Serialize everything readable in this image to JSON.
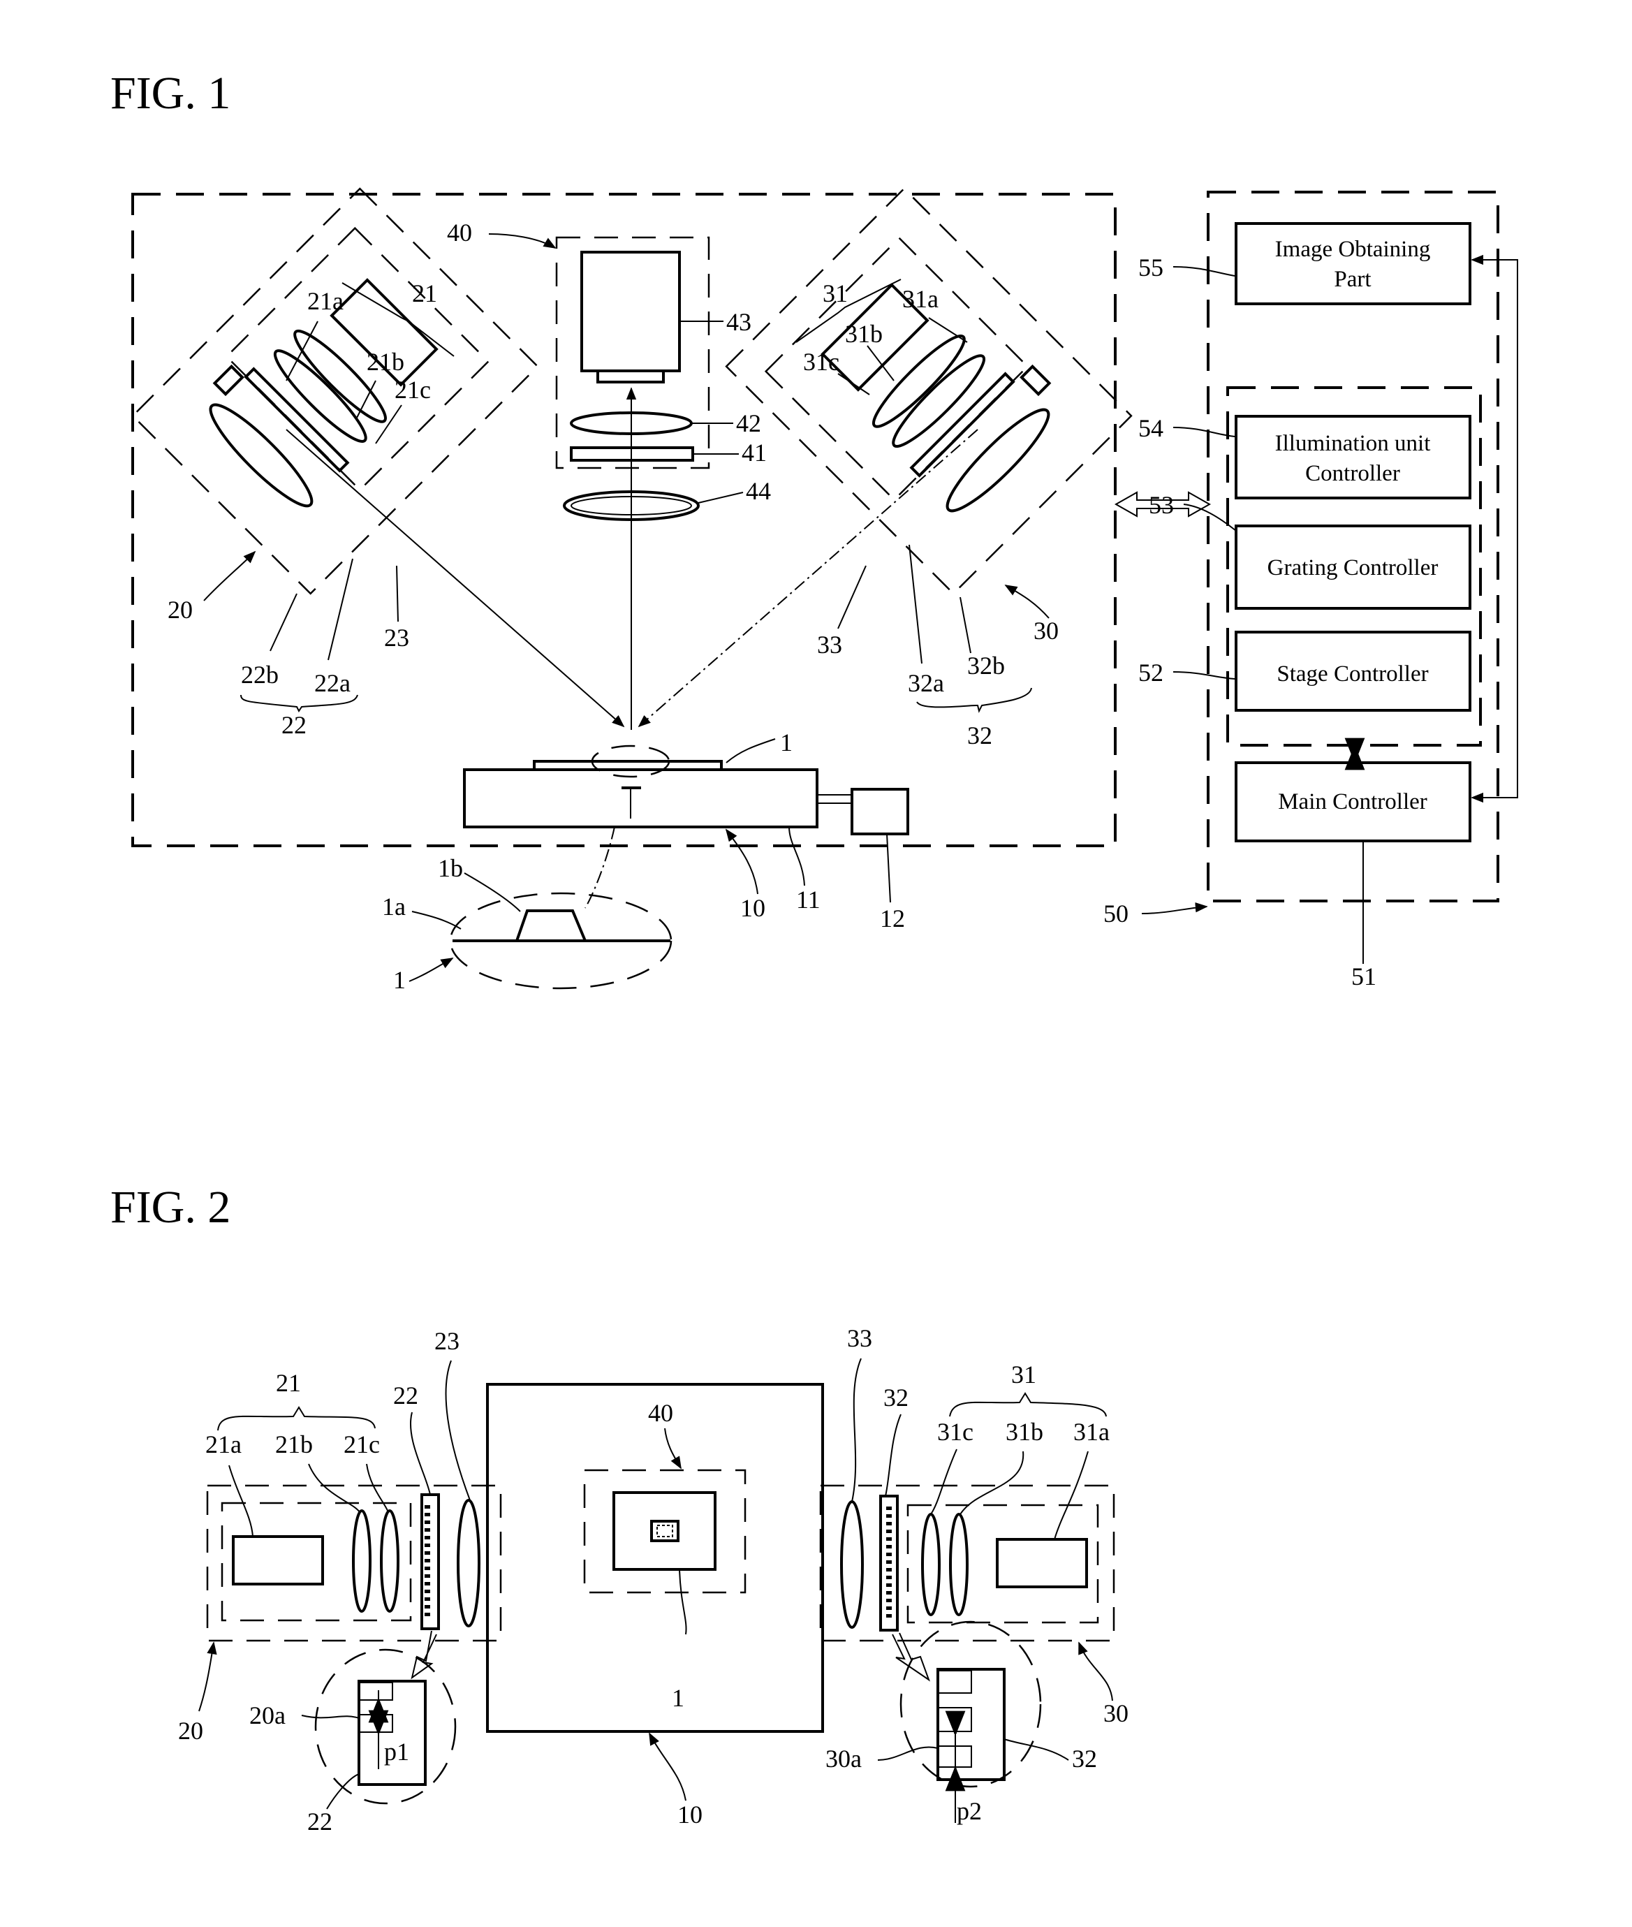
{
  "fig1": {
    "title": "FIG. 1",
    "boxes": {
      "image_obtaining": [
        "Image Obtaining",
        "Part"
      ],
      "illumination_controller": [
        "Illumination unit",
        "Controller"
      ],
      "grating_controller": "Grating Controller",
      "stage_controller": "Stage Controller",
      "main_controller": "Main Controller"
    },
    "labels": {
      "l40": "40",
      "l43": "43",
      "l42": "42",
      "l41": "41",
      "l44": "44",
      "l21": "21",
      "l21a": "21a",
      "l21b": "21b",
      "l21c": "21c",
      "l20": "20",
      "l22b": "22b",
      "l22a": "22a",
      "l22": "22",
      "l23": "23",
      "l31": "31",
      "l31a": "31a",
      "l31b": "31b",
      "l31c": "31c",
      "l30": "30",
      "l33": "33",
      "l32a": "32a",
      "l32b": "32b",
      "l32": "32",
      "l1": "1",
      "l1a": "1a",
      "l1b": "1b",
      "l1_detail": "1",
      "l10": "10",
      "l11": "11",
      "l12": "12",
      "l55": "55",
      "l54": "54",
      "l53": "53",
      "l52": "52",
      "l50": "50",
      "l51": "51"
    }
  },
  "fig2": {
    "title": "FIG. 2",
    "labels": {
      "l21": "21",
      "l21a": "21a",
      "l21b": "21b",
      "l21c": "21c",
      "l22": "22",
      "l23": "23",
      "l20": "20",
      "l20a": "20a",
      "lp1": "p1",
      "l22_detail": "22",
      "l33": "33",
      "l32": "32",
      "l31": "31",
      "l31c": "31c",
      "l31b": "31b",
      "l31a": "31a",
      "l30": "30",
      "l30a": "30a",
      "lp2": "p2",
      "l32_detail": "32",
      "l40": "40",
      "l1": "1",
      "l10": "10"
    }
  }
}
